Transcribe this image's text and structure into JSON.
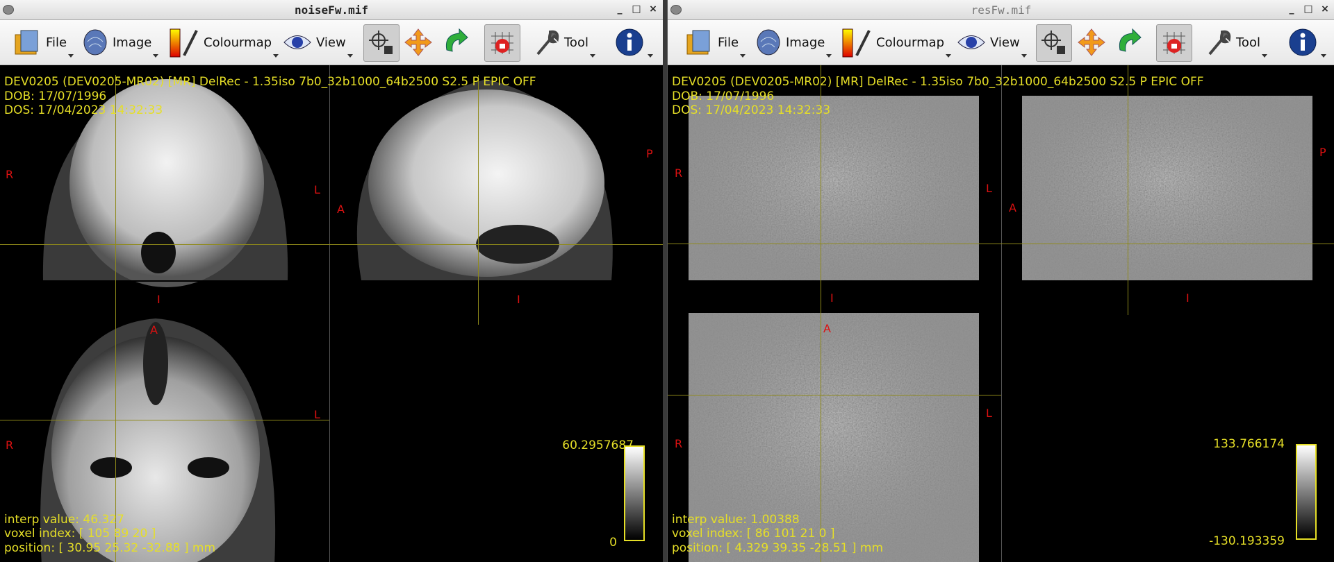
{
  "windows": [
    {
      "title": "noiseFw.mif",
      "header_lines": [
        "DEV0205 (DEV0205-MR02) [MR] DelRec - 1.35iso 7b0_32b1000_64b2500 S2.5 P EPIC OFF",
        "DOB: 17/07/1996",
        "DOS: 17/04/2023 14:32:33"
      ],
      "info_lines": [
        "interp value: 46.327",
        "voxel index: [ 105 89 20 ]",
        "position: [ 30.95 25.32 -32.88 ] mm"
      ],
      "colorbar": {
        "max": "60.2957687",
        "min": "0"
      }
    },
    {
      "title": "resFw.mif",
      "header_lines": [
        "DEV0205 (DEV0205-MR02) [MR] DelRec - 1.35iso 7b0_32b1000_64b2500 S2.5 P EPIC OFF",
        "DOB: 17/07/1996",
        "DOS: 17/04/2023 14:32:33"
      ],
      "info_lines": [
        "interp value: 1.00388",
        "voxel index: [ 86 101 21 0 ]",
        "position: [ 4.329 39.35 -28.51 ] mm"
      ],
      "colorbar": {
        "max": "133.766174",
        "min": "-130.193359"
      }
    }
  ],
  "toolbar": {
    "file": "File",
    "image": "Image",
    "colourmap": "Colourmap",
    "view": "View",
    "tool": "Tool"
  },
  "window_controls": {
    "minimize": "_",
    "maximize": "□",
    "close": "×"
  },
  "orientation": {
    "R": "R",
    "L": "L",
    "A": "A",
    "P": "P",
    "I": "I"
  },
  "colors": {
    "overlay_text": "#e6df27",
    "orientation_text": "#dd1111",
    "crosshair": "#8f8a1a"
  }
}
